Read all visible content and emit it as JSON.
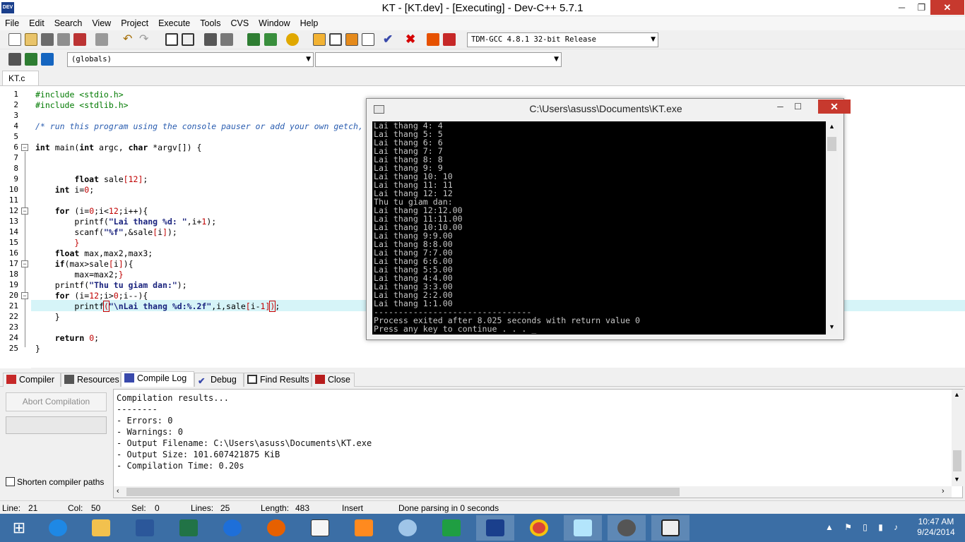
{
  "window": {
    "title": "KT - [KT.dev] - [Executing] - Dev-C++ 5.7.1",
    "app_icon_text": "DEV",
    "minimize": "─",
    "maximize": "❐",
    "close": "✕"
  },
  "menu": [
    "File",
    "Edit",
    "Search",
    "View",
    "Project",
    "Execute",
    "Tools",
    "CVS",
    "Window",
    "Help"
  ],
  "toolbar": {
    "compiler_select": "TDM-GCC 4.8.1 32-bit Release",
    "scope_select": "(globals)",
    "function_select": ""
  },
  "editor_tab": "KT.c",
  "code_lines": [
    {
      "n": "1",
      "html": "<span class=\"pp\">#include &lt;stdio.h&gt;</span>"
    },
    {
      "n": "2",
      "html": "<span class=\"pp\">#include &lt;stdlib.h&gt;</span>"
    },
    {
      "n": "3",
      "html": ""
    },
    {
      "n": "4",
      "html": "<span class=\"cmt\">/* run this program using the console pauser or add your own getch,</span>"
    },
    {
      "n": "5",
      "html": ""
    },
    {
      "n": "6",
      "html": "<span class=\"kw\">int</span> main(<span class=\"kw\">int</span> argc, <span class=\"kw\">char</span> *argv[]) {"
    },
    {
      "n": "7",
      "html": ""
    },
    {
      "n": "8",
      "html": ""
    },
    {
      "n": "9",
      "html": "        <span class=\"kw\">float</span> sale<span class=\"sym\">[</span><span class=\"num\">12</span><span class=\"sym\">]</span>;"
    },
    {
      "n": "10",
      "html": "    <span class=\"kw\">int</span> i=<span class=\"num\">0</span>;"
    },
    {
      "n": "11",
      "html": ""
    },
    {
      "n": "12",
      "html": "    <span class=\"kw\">for</span> (i=<span class=\"num\">0</span>;i&lt;<span class=\"num\">12</span>;i++){"
    },
    {
      "n": "13",
      "html": "        printf(<span class=\"str\">\"Lai thang %d: \"</span>,i+<span class=\"num\">1</span>);"
    },
    {
      "n": "14",
      "html": "        scanf(<span class=\"str\">\"%f\"</span>,&amp;sale<span class=\"sym\">[</span>i<span class=\"sym\">]</span>);"
    },
    {
      "n": "15",
      "html": "        <span class=\"sym\">}</span>"
    },
    {
      "n": "16",
      "html": "    <span class=\"kw\">float</span> max,max2,max3;"
    },
    {
      "n": "17",
      "html": "    <span class=\"kw\">if</span>(max&gt;sale<span class=\"sym\">[</span>i<span class=\"sym\">]</span>){"
    },
    {
      "n": "18",
      "html": "        max=max2;<span class=\"sym\">}</span>"
    },
    {
      "n": "19",
      "html": "    printf(<span class=\"str\">\"Thu tu giam dan:\"</span>);"
    },
    {
      "n": "20",
      "html": "    <span class=\"kw\">for</span> (i=<span class=\"num\">12</span>;i&gt;<span class=\"num\">0</span>;i--){"
    },
    {
      "n": "21",
      "html": "        printf<span style=\"outline:1px solid #c00;color:#c00\">(</span><span class=\"str\">\"\\nLai thang %d:%.2f\"</span>,i,sale<span class=\"sym\">[</span>i-<span class=\"num\">1</span><span class=\"sym\">]</span><span style=\"outline:1px solid #c00;color:#c00\">)</span>;"
    },
    {
      "n": "22",
      "html": "    }"
    },
    {
      "n": "23",
      "html": ""
    },
    {
      "n": "24",
      "html": "    <span class=\"kw\">return</span> <span class=\"num\">0</span>;"
    },
    {
      "n": "25",
      "html": "}"
    }
  ],
  "console": {
    "title": "C:\\Users\\asuss\\Documents\\KT.exe",
    "output": "Lai thang 4: 4\nLai thang 5: 5\nLai thang 6: 6\nLai thang 7: 7\nLai thang 8: 8\nLai thang 9: 9\nLai thang 10: 10\nLai thang 11: 11\nLai thang 12: 12\nThu tu giam dan:\nLai thang 12:12.00\nLai thang 11:11.00\nLai thang 10:10.00\nLai thang 9:9.00\nLai thang 8:8.00\nLai thang 7:7.00\nLai thang 6:6.00\nLai thang 5:5.00\nLai thang 4:4.00\nLai thang 3:3.00\nLai thang 2:2.00\nLai thang 1:1.00\n--------------------------------\nProcess exited after 8.025 seconds with return value 0\nPress any key to continue . . . _"
  },
  "bottom_tabs": [
    "Compiler",
    "Resources",
    "Compile Log",
    "Debug",
    "Find Results",
    "Close"
  ],
  "compile_log": {
    "abort_label": "Abort Compilation",
    "shorten_label": "Shorten compiler paths",
    "text": "Compilation results...\n--------\n- Errors: 0\n- Warnings: 0\n- Output Filename: C:\\Users\\asuss\\Documents\\KT.exe\n- Output Size: 101.607421875 KiB\n- Compilation Time: 0.20s"
  },
  "status": {
    "line_label": "Line:",
    "line": "21",
    "col_label": "Col:",
    "col": "50",
    "sel_label": "Sel:",
    "sel": "0",
    "lines_label": "Lines:",
    "lines": "25",
    "length_label": "Length:",
    "length": "483",
    "mode": "Insert",
    "parse": "Done parsing in 0 seconds"
  },
  "clock": {
    "time": "10:47 AM",
    "date": "9/24/2014"
  },
  "colors": {
    "accent": "#3b6ea5",
    "close_red": "#c7392e",
    "highlight_line": "#d6f4f8"
  }
}
